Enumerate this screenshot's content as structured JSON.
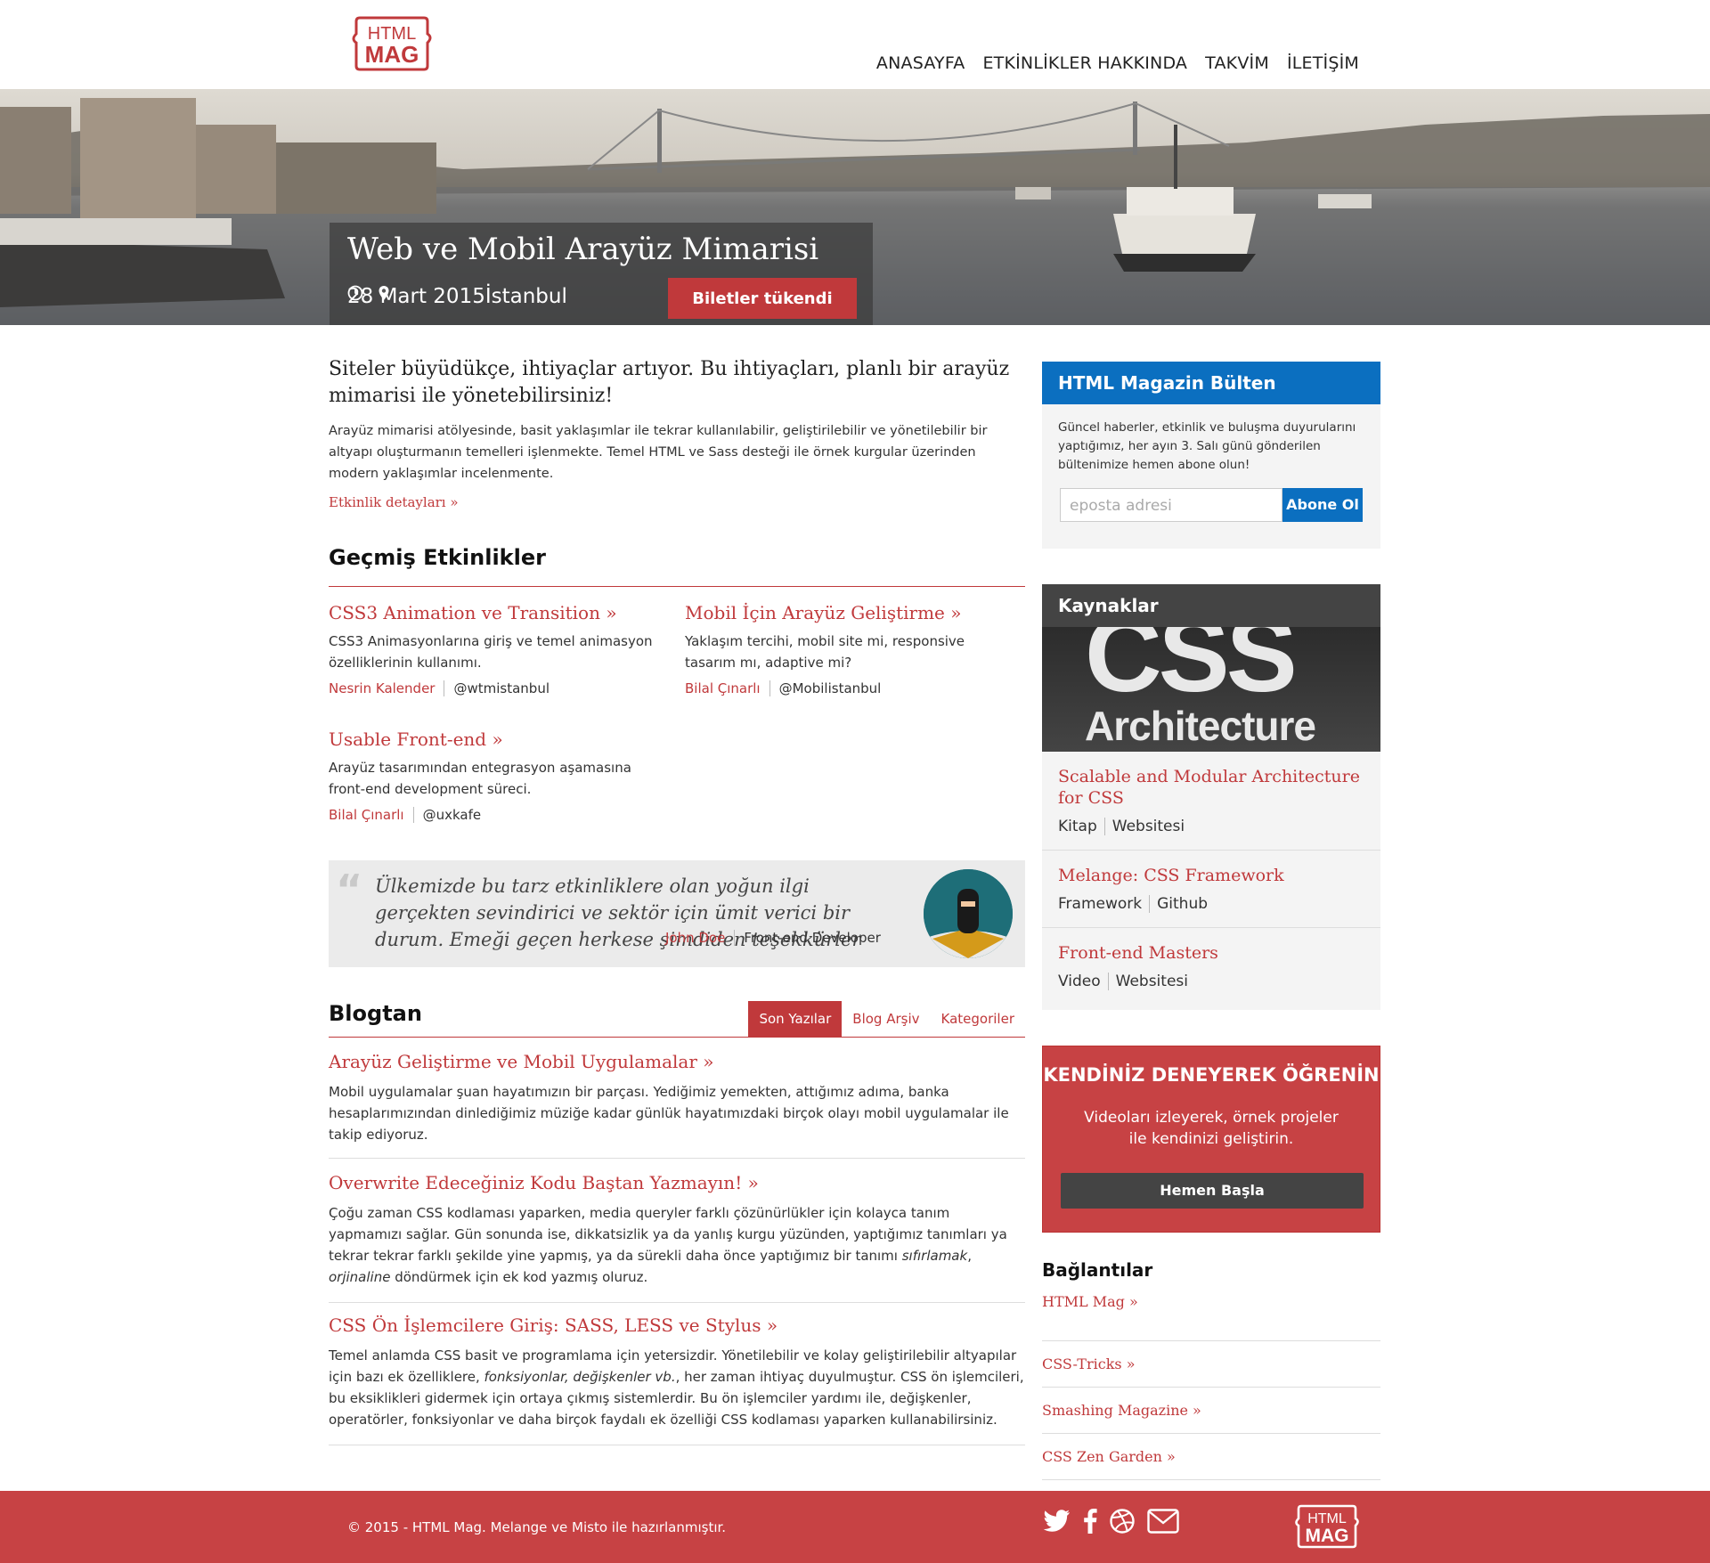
{
  "header": {
    "logo_top": "HTML",
    "logo_bottom": "MAG",
    "nav": [
      "ANASAYFA",
      "ETKİNLİKLER HAKKINDA",
      "TAKVİM",
      "İLETİŞİM"
    ]
  },
  "hero": {
    "title": "Web ve Mobil Arayüz Mimarisi",
    "date": "28 Mart 2015",
    "location": "İstanbul",
    "button": "Biletler tükendi"
  },
  "intro": {
    "lead": "Siteler büyüdükçe, ihtiyaçlar artıyor. Bu ihtiyaçları, planlı bir arayüz mimarisi ile yönetebilirsiniz!",
    "text": "Arayüz mimarisi atölyesinde, basit yaklaşımlar ile tekrar kullanılabilir, geliştirilebilir ve yönetilebilir bir altyapı oluşturmanın temelleri işlenmekte. Temel HTML ve Sass desteği ile örnek kurgular üzerinden modern yaklaşımlar incelenmente.",
    "link": "Etkinlik detayları »"
  },
  "past_events": {
    "title": "Geçmiş Etkinlikler",
    "items": [
      {
        "title": "CSS3 Animation ve Transition »",
        "desc": "CSS3 Animasyonlarına giriş ve temel animasyon özelliklerinin kullanımı.",
        "author": "Nesrin Kalender",
        "handle": "@wtmistanbul"
      },
      {
        "title": "Mobil İçin Arayüz Geliştirme »",
        "desc": "Yaklaşım tercihi, mobil site mi, responsive tasarım mı, adaptive mi?",
        "author": "Bilal Çınarlı",
        "handle": "@Mobilistanbul"
      },
      {
        "title": "Usable Front-end »",
        "desc": "Arayüz tasarımından entegrasyon aşamasına front-end development süreci.",
        "author": "Bilal Çınarlı",
        "handle": "@uxkafe"
      }
    ]
  },
  "quote": {
    "text": "Ülkemizde bu tarz etkinliklere olan yoğun ilgi gerçekten sevindirici ve sektör için ümit verici bir durum. Emeği geçen herkese şimdiden teşekkürler",
    "name": "John Doe",
    "role": "Front-end Developer"
  },
  "blog": {
    "title": "Blogtan",
    "tabs": [
      "Son Yazılar",
      "Blog Arşiv",
      "Kategoriler"
    ],
    "posts": [
      {
        "title": "Arayüz Geliştirme ve Mobil Uygulamalar »",
        "body": "Mobil uygulamalar şuan hayatımızın bir parçası. Yediğimiz yemekten, attığımız adıma, banka hesaplarımızından dinlediğimiz müziğe kadar günlük hayatımızdaki birçok olayı mobil uygulamalar ile takip ediyoruz."
      },
      {
        "title": "Overwrite Edeceğiniz Kodu Baştan Yazmayın! »",
        "body_a": "Çoğu zaman CSS kodlaması yaparken, media queryler farklı çözünürlükler için kolayca tanım yapmamızı sağlar. Gün sonunda ise, dikkatsizlik ya da yanlış kurgu yüzünden, yaptığımız tanımları ya tekrar tekrar farklı şekilde yine yapmış, ya da sürekli daha önce yaptığımız bir tanımı ",
        "em_a": "sıfırlamak",
        "sep": ", ",
        "em_b": "orjinaline",
        "body_b": " döndürmek için ek kod yazmış oluruz."
      },
      {
        "title": "CSS Ön İşlemcilere Giriş: SASS, LESS ve Stylus »",
        "body_a": "Temel anlamda CSS basit ve programlama için yetersizdir. Yönetilebilir ve kolay geliştirilebilir altyapılar için bazı ek özelliklere, ",
        "em": "fonksiyonlar, değişkenler vb.",
        "body_b": ", her zaman ihtiyaç duyulmuştur. CSS ön işlemcileri, bu eksiklikleri gidermek için ortaya çıkmış sistemlerdir. Bu ön işlemciler yardımı ile, değişkenler, operatörler, fonksiyonlar ve daha birçok faydalı ek özelliği CSS kodlaması yaparken kullanabilirsiniz."
      }
    ]
  },
  "newsletter": {
    "title": "HTML Magazin Bülten",
    "text": "Güncel haberler, etkinlik ve buluşma duyurularını yaptığımız, her ayın 3. Salı günü gönderilen bültenimize hemen abone olun!",
    "placeholder": "eposta adresi",
    "button": "Abone Ol"
  },
  "resources": {
    "title": "Kaynaklar",
    "image_big": "CSS",
    "image_sub": "Architecture",
    "items": [
      {
        "title": "Scalable and Modular Architecture for CSS",
        "a": "Kitap",
        "b": "Websitesi"
      },
      {
        "title": "Melange: CSS Framework",
        "a": "Framework",
        "b": "Github"
      },
      {
        "title": "Front-end Masters",
        "a": "Video",
        "b": "Websitesi"
      }
    ]
  },
  "cta": {
    "title": "KENDİNİZ DENEYEREK ÖĞRENİN",
    "text": "Videoları izleyerek, örnek projeler ile kendinizi geliştirin.",
    "button": "Hemen Başla"
  },
  "links": {
    "title": "Bağlantılar",
    "items": [
      "HTML Mag »",
      "CSS-Tricks »",
      "Smashing Magazine »",
      "CSS Zen Garden »"
    ]
  },
  "footer": {
    "text": "© 2015 - HTML Mag. Melange ve Misto ile hazırlanmıştır.",
    "logo_top": "HTML",
    "logo_bottom": "MAG"
  },
  "colors": {
    "brand_red": "#c0393b",
    "footer_red": "#c74244",
    "newsletter_blue": "#0b6fc0",
    "dark": "#444444"
  },
  "icons": [
    "clock-icon",
    "map-pin-icon",
    "twitter-icon",
    "facebook-icon",
    "dribbble-icon",
    "mail-icon"
  ]
}
